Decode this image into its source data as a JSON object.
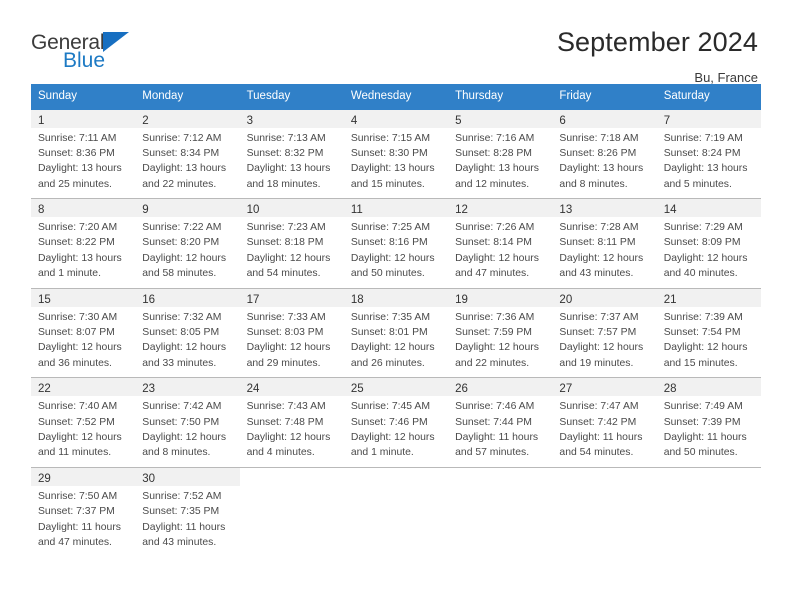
{
  "brand": {
    "name_part1": "General",
    "name_part2": "Blue",
    "triangle_icon": "triangle-icon",
    "accent_color": "#1d7ac4"
  },
  "header": {
    "title": "September 2024",
    "subtitle": "Bu, France"
  },
  "theme": {
    "header_row_bg": "#3080c8",
    "daynum_strip_bg": "#f1f1f1",
    "grid_line": "#b9b9b9",
    "text": "#4a4a4a"
  },
  "weekdays": [
    "Sunday",
    "Monday",
    "Tuesday",
    "Wednesday",
    "Thursday",
    "Friday",
    "Saturday"
  ],
  "weeks": [
    [
      {
        "day": "1",
        "sunrise": "Sunrise: 7:11 AM",
        "sunset": "Sunset: 8:36 PM",
        "daylight1": "Daylight: 13 hours",
        "daylight2": "and 25 minutes."
      },
      {
        "day": "2",
        "sunrise": "Sunrise: 7:12 AM",
        "sunset": "Sunset: 8:34 PM",
        "daylight1": "Daylight: 13 hours",
        "daylight2": "and 22 minutes."
      },
      {
        "day": "3",
        "sunrise": "Sunrise: 7:13 AM",
        "sunset": "Sunset: 8:32 PM",
        "daylight1": "Daylight: 13 hours",
        "daylight2": "and 18 minutes."
      },
      {
        "day": "4",
        "sunrise": "Sunrise: 7:15 AM",
        "sunset": "Sunset: 8:30 PM",
        "daylight1": "Daylight: 13 hours",
        "daylight2": "and 15 minutes."
      },
      {
        "day": "5",
        "sunrise": "Sunrise: 7:16 AM",
        "sunset": "Sunset: 8:28 PM",
        "daylight1": "Daylight: 13 hours",
        "daylight2": "and 12 minutes."
      },
      {
        "day": "6",
        "sunrise": "Sunrise: 7:18 AM",
        "sunset": "Sunset: 8:26 PM",
        "daylight1": "Daylight: 13 hours",
        "daylight2": "and 8 minutes."
      },
      {
        "day": "7",
        "sunrise": "Sunrise: 7:19 AM",
        "sunset": "Sunset: 8:24 PM",
        "daylight1": "Daylight: 13 hours",
        "daylight2": "and 5 minutes."
      }
    ],
    [
      {
        "day": "8",
        "sunrise": "Sunrise: 7:20 AM",
        "sunset": "Sunset: 8:22 PM",
        "daylight1": "Daylight: 13 hours",
        "daylight2": "and 1 minute."
      },
      {
        "day": "9",
        "sunrise": "Sunrise: 7:22 AM",
        "sunset": "Sunset: 8:20 PM",
        "daylight1": "Daylight: 12 hours",
        "daylight2": "and 58 minutes."
      },
      {
        "day": "10",
        "sunrise": "Sunrise: 7:23 AM",
        "sunset": "Sunset: 8:18 PM",
        "daylight1": "Daylight: 12 hours",
        "daylight2": "and 54 minutes."
      },
      {
        "day": "11",
        "sunrise": "Sunrise: 7:25 AM",
        "sunset": "Sunset: 8:16 PM",
        "daylight1": "Daylight: 12 hours",
        "daylight2": "and 50 minutes."
      },
      {
        "day": "12",
        "sunrise": "Sunrise: 7:26 AM",
        "sunset": "Sunset: 8:14 PM",
        "daylight1": "Daylight: 12 hours",
        "daylight2": "and 47 minutes."
      },
      {
        "day": "13",
        "sunrise": "Sunrise: 7:28 AM",
        "sunset": "Sunset: 8:11 PM",
        "daylight1": "Daylight: 12 hours",
        "daylight2": "and 43 minutes."
      },
      {
        "day": "14",
        "sunrise": "Sunrise: 7:29 AM",
        "sunset": "Sunset: 8:09 PM",
        "daylight1": "Daylight: 12 hours",
        "daylight2": "and 40 minutes."
      }
    ],
    [
      {
        "day": "15",
        "sunrise": "Sunrise: 7:30 AM",
        "sunset": "Sunset: 8:07 PM",
        "daylight1": "Daylight: 12 hours",
        "daylight2": "and 36 minutes."
      },
      {
        "day": "16",
        "sunrise": "Sunrise: 7:32 AM",
        "sunset": "Sunset: 8:05 PM",
        "daylight1": "Daylight: 12 hours",
        "daylight2": "and 33 minutes."
      },
      {
        "day": "17",
        "sunrise": "Sunrise: 7:33 AM",
        "sunset": "Sunset: 8:03 PM",
        "daylight1": "Daylight: 12 hours",
        "daylight2": "and 29 minutes."
      },
      {
        "day": "18",
        "sunrise": "Sunrise: 7:35 AM",
        "sunset": "Sunset: 8:01 PM",
        "daylight1": "Daylight: 12 hours",
        "daylight2": "and 26 minutes."
      },
      {
        "day": "19",
        "sunrise": "Sunrise: 7:36 AM",
        "sunset": "Sunset: 7:59 PM",
        "daylight1": "Daylight: 12 hours",
        "daylight2": "and 22 minutes."
      },
      {
        "day": "20",
        "sunrise": "Sunrise: 7:37 AM",
        "sunset": "Sunset: 7:57 PM",
        "daylight1": "Daylight: 12 hours",
        "daylight2": "and 19 minutes."
      },
      {
        "day": "21",
        "sunrise": "Sunrise: 7:39 AM",
        "sunset": "Sunset: 7:54 PM",
        "daylight1": "Daylight: 12 hours",
        "daylight2": "and 15 minutes."
      }
    ],
    [
      {
        "day": "22",
        "sunrise": "Sunrise: 7:40 AM",
        "sunset": "Sunset: 7:52 PM",
        "daylight1": "Daylight: 12 hours",
        "daylight2": "and 11 minutes."
      },
      {
        "day": "23",
        "sunrise": "Sunrise: 7:42 AM",
        "sunset": "Sunset: 7:50 PM",
        "daylight1": "Daylight: 12 hours",
        "daylight2": "and 8 minutes."
      },
      {
        "day": "24",
        "sunrise": "Sunrise: 7:43 AM",
        "sunset": "Sunset: 7:48 PM",
        "daylight1": "Daylight: 12 hours",
        "daylight2": "and 4 minutes."
      },
      {
        "day": "25",
        "sunrise": "Sunrise: 7:45 AM",
        "sunset": "Sunset: 7:46 PM",
        "daylight1": "Daylight: 12 hours",
        "daylight2": "and 1 minute."
      },
      {
        "day": "26",
        "sunrise": "Sunrise: 7:46 AM",
        "sunset": "Sunset: 7:44 PM",
        "daylight1": "Daylight: 11 hours",
        "daylight2": "and 57 minutes."
      },
      {
        "day": "27",
        "sunrise": "Sunrise: 7:47 AM",
        "sunset": "Sunset: 7:42 PM",
        "daylight1": "Daylight: 11 hours",
        "daylight2": "and 54 minutes."
      },
      {
        "day": "28",
        "sunrise": "Sunrise: 7:49 AM",
        "sunset": "Sunset: 7:39 PM",
        "daylight1": "Daylight: 11 hours",
        "daylight2": "and 50 minutes."
      }
    ],
    [
      {
        "day": "29",
        "sunrise": "Sunrise: 7:50 AM",
        "sunset": "Sunset: 7:37 PM",
        "daylight1": "Daylight: 11 hours",
        "daylight2": "and 47 minutes."
      },
      {
        "day": "30",
        "sunrise": "Sunrise: 7:52 AM",
        "sunset": "Sunset: 7:35 PM",
        "daylight1": "Daylight: 11 hours",
        "daylight2": "and 43 minutes."
      },
      {
        "day": "",
        "sunrise": "",
        "sunset": "",
        "daylight1": "",
        "daylight2": ""
      },
      {
        "day": "",
        "sunrise": "",
        "sunset": "",
        "daylight1": "",
        "daylight2": ""
      },
      {
        "day": "",
        "sunrise": "",
        "sunset": "",
        "daylight1": "",
        "daylight2": ""
      },
      {
        "day": "",
        "sunrise": "",
        "sunset": "",
        "daylight1": "",
        "daylight2": ""
      },
      {
        "day": "",
        "sunrise": "",
        "sunset": "",
        "daylight1": "",
        "daylight2": ""
      }
    ]
  ]
}
